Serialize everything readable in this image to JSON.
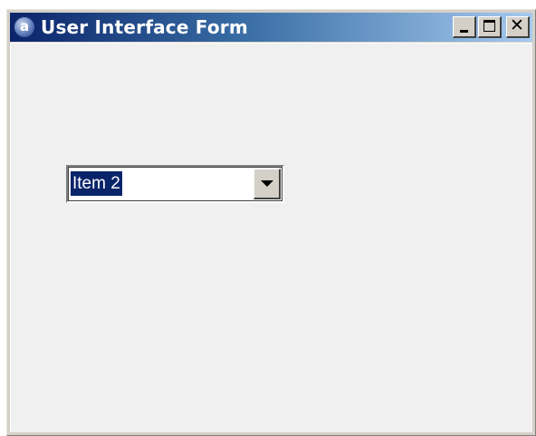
{
  "window": {
    "title": "User Interface Form",
    "icon": "app-logo-icon",
    "icon_glyph": "a",
    "controls": [
      "minimize-icon",
      "maximize-icon",
      "close-icon"
    ],
    "close_glyph": "✕"
  },
  "form": {
    "combo": {
      "selected_value": "Item 2",
      "dropdown_icon": "chevron-down-icon"
    }
  },
  "colors": {
    "title_gradient_start": "#0a246a",
    "title_gradient_end": "#a6caf0",
    "selection_bg": "#0a246a",
    "client_bg": "#f0f0f0"
  }
}
